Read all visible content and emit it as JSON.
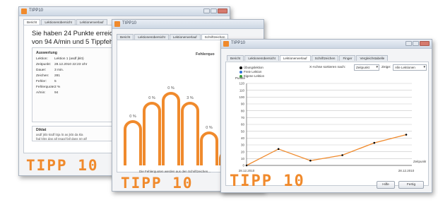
{
  "colors": {
    "accent": "#f08a2c",
    "window_border": "#a9b3c0",
    "series_dot": "#000000"
  },
  "window1": {
    "title": "TIPP10",
    "tabs": [
      "Bericht",
      "Lektionenübersicht",
      "Lektionenverlauf"
    ],
    "headline_line1": "Sie haben 24 Punkte erreic",
    "headline_line2": "von 94 A/min und 5 Tippfeh",
    "summary": {
      "title": "Auswertung",
      "rows": [
        {
          "key": "Lektion:",
          "value": "Lektion 1 (asdf jklö)"
        },
        {
          "key": "Zeitpunkt:",
          "value": "28.12.2010 22:23 Uhr"
        },
        {
          "key": "Dauer:",
          "value": "3 min."
        },
        {
          "key": "Zeichen:",
          "value": "281"
        },
        {
          "key": "Fehler:",
          "value": "5"
        },
        {
          "key": "Fehlerquote:",
          "value": "2 %"
        },
        {
          "key": "A/min:",
          "value": "94"
        }
      ]
    },
    "dictation": {
      "title": "Diktat",
      "line1": "asdf jklö ködf löja lö as jklö da kla",
      "line2": "fad klös das all ösaal fall dass öö alf"
    },
    "logo": "TIPP 10"
  },
  "window2": {
    "title": "TIPP10",
    "tabs": [
      "Bericht",
      "Lektionenübersicht",
      "Lektionenverlauf",
      "Schriftzeichen",
      "Finger",
      "Vergleichstabelle"
    ],
    "chart_title": "Fehlerquo",
    "footnote": "Die Fehlerquoten werden aus den Schriftzeichen...",
    "logo": "TIPP 10"
  },
  "window3": {
    "title": "TIPP10",
    "tabs": [
      "Bericht",
      "Lektionenübersicht",
      "Lektionenverlauf",
      "Schriftzeichen",
      "Finger",
      "Vergleichstabelle"
    ],
    "active_tab_index": 2,
    "sort_label": "X-Achse sortieren nach:",
    "sort_value": "Zeitpunkt",
    "show_label": "Zeige:",
    "show_value": "Alle Lektionen",
    "legend": [
      {
        "label": "Übungslektion",
        "color": "#000000"
      },
      {
        "label": "Freie Lektion",
        "color": "#2f6fd6"
      },
      {
        "label": "Eigene Lektion",
        "color": "#3aa33a"
      }
    ],
    "ylabel": "Punkte",
    "buttons": {
      "help": "Hilfe",
      "done": "Fertig"
    },
    "logo": "TIPP 10"
  },
  "chart_data": [
    {
      "type": "bar",
      "title": "Fehlerquo",
      "categories": [
        "1",
        "2",
        "3",
        "4",
        "5",
        "6"
      ],
      "values": [
        0,
        0,
        0,
        0,
        0,
        0
      ],
      "value_labels": [
        "0 %",
        "0 %",
        "0 %",
        "3 %",
        "0 %",
        ""
      ]
    },
    {
      "type": "line",
      "xlabel": "Zeitpunkt",
      "ylabel": "Punkte",
      "x": [
        "28.12.2010",
        "",
        "",
        "",
        "",
        "28.12.2010"
      ],
      "x_tick_labels": [
        "28.12.2010",
        "28.12.2010"
      ],
      "ylim": [
        0,
        120
      ],
      "yticks": [
        0,
        10,
        20,
        30,
        40,
        50,
        60,
        70,
        80,
        90,
        100,
        110,
        120
      ],
      "series": [
        {
          "values": [
            0,
            24,
            7,
            15,
            33,
            45
          ]
        }
      ],
      "grid": true
    }
  ]
}
